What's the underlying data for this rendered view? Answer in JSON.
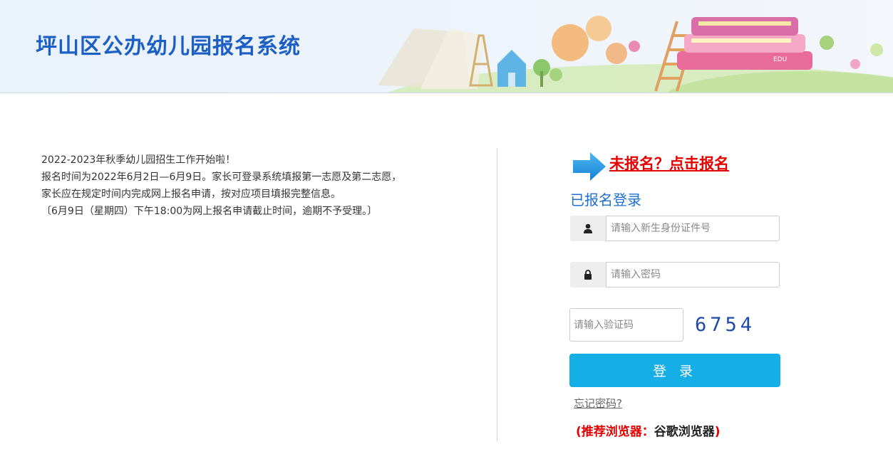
{
  "header": {
    "title": "坪山区公办幼儿园报名系统",
    "badge": "EDU"
  },
  "notice": {
    "lines": [
      "2022-2023年秋季幼儿园招生工作开始啦！",
      "报名时间为2022年6月2日—6月9日。家长可登录系统填报第一志愿及第二志愿，",
      "家长应在规定时间内完成网上报名申请，按对应项目填报完整信息。",
      "〔6月9日（星期四）下午18:00为网上报名申请截止时间，逾期不予受理。〕"
    ]
  },
  "login": {
    "register_link": "未报名？点击报名",
    "title": "已报名登录",
    "id_placeholder": "请输入新生身份证件号",
    "password_placeholder": "请输入密码",
    "captcha_placeholder": "请输入验证码",
    "captcha_code": "6754",
    "login_button": "登 录",
    "forgot_password": "忘记密码?",
    "browser_tip_prefix": "(推荐浏览器：",
    "browser_tip_name": "谷歌浏览器",
    "browser_tip_suffix": ")"
  },
  "colors": {
    "title_blue": "#1c5fc4",
    "link_red": "#e60000",
    "button_blue": "#16aee6",
    "login_title_blue": "#1d6fd0"
  },
  "icons": {
    "register_arrow": "arrow-right-icon",
    "id_addon": "user-icon",
    "password_addon": "lock-icon"
  }
}
